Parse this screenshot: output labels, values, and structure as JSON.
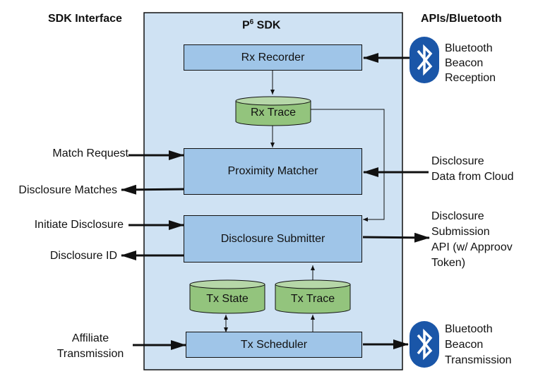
{
  "headers": {
    "left": "SDK Interface",
    "center_base": "P",
    "center_sup": "6",
    "center_suffix": " SDK",
    "right": "APIs/Bluetooth"
  },
  "components": {
    "rx_recorder": "Rx Recorder",
    "rx_trace": "Rx Trace",
    "proximity_matcher": "Proximity Matcher",
    "disclosure_submitter": "Disclosure Submitter",
    "tx_state": "Tx State",
    "tx_trace": "Tx Trace",
    "tx_scheduler": "Tx Scheduler"
  },
  "interface": {
    "match_request": "Match Request",
    "disclosure_matches": "Disclosure Matches",
    "initiate_disclosure": "Initiate Disclosure",
    "disclosure_id": "Disclosure ID",
    "affiliate_line1": "Affiliate",
    "affiliate_line2": "Transmission"
  },
  "apis": {
    "reception_lines": [
      "Bluetooth",
      "Beacon",
      "Reception"
    ],
    "cloud_lines": [
      "Disclosure",
      "Data from Cloud"
    ],
    "submission_lines": [
      "Disclosure",
      "Submission",
      "API (w/ Approov",
      "Token)"
    ],
    "transmission_lines": [
      "Bluetooth",
      "Beacon",
      "Transmission"
    ]
  },
  "colors": {
    "sdk_background": "#cfe2f3",
    "component_fill": "#9fc5e8",
    "store_fill": "#93c47d",
    "store_top": "#b6d7a8",
    "bluetooth_blue": "#1a56a8"
  }
}
